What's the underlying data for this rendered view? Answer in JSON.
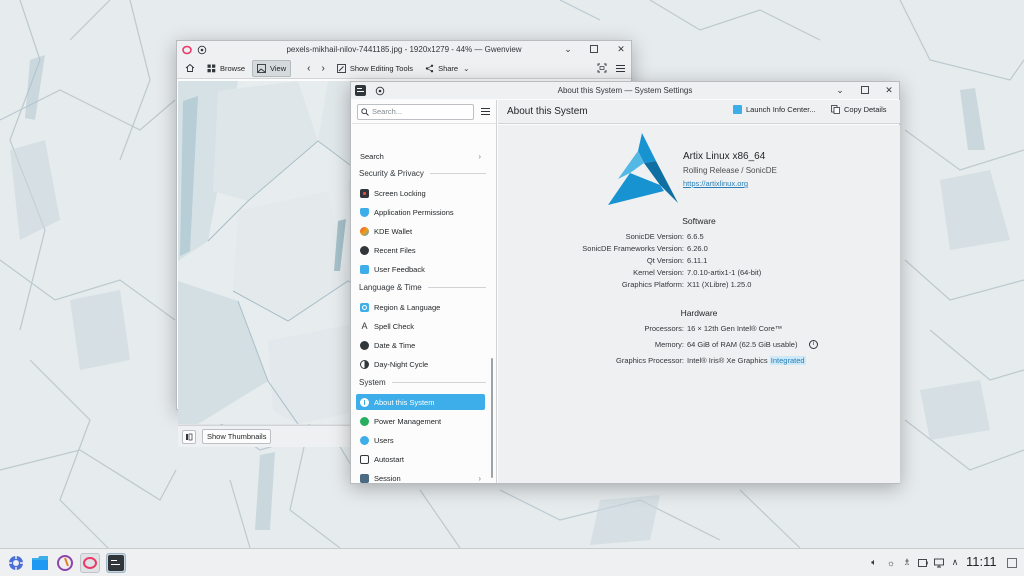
{
  "gwenview": {
    "title": "pexels-mikhail-nilov-7441185.jpg - 1920x1279 - 44% — Gwenview",
    "toolbar": {
      "browse": "Browse",
      "view": "View",
      "show_editing_tools": "Show Editing Tools",
      "share": "Share"
    },
    "show_thumbnails": "Show Thumbnails"
  },
  "settings": {
    "title": "About this System — System Settings",
    "search_placeholder": "Search...",
    "page_title": "About this System",
    "launch_info_center": "Launch Info Center...",
    "copy_details": "Copy Details",
    "sidebar": {
      "search": "Search",
      "security_privacy": "Security & Privacy",
      "screen_locking": "Screen Locking",
      "application_permissions": "Application Permissions",
      "kde_wallet": "KDE Wallet",
      "recent_files": "Recent Files",
      "user_feedback": "User Feedback",
      "language_time": "Language & Time",
      "region_language": "Region & Language",
      "spell_check": "Spell Check",
      "date_time": "Date & Time",
      "day_night_cycle": "Day-Night Cycle",
      "system": "System",
      "about_this_system": "About this System",
      "power_management": "Power Management",
      "users": "Users",
      "autostart": "Autostart",
      "session": "Session"
    },
    "distro": {
      "name": "Artix Linux x86_64",
      "release": "Rolling Release / SonicDE",
      "url": "https://artixlinux.org"
    },
    "software": {
      "heading": "Software",
      "rows": [
        {
          "key": "SonicDE Version:",
          "value": "6.6.5"
        },
        {
          "key": "SonicDE Frameworks Version:",
          "value": "6.26.0"
        },
        {
          "key": "Qt Version:",
          "value": "6.11.1"
        },
        {
          "key": "Kernel Version:",
          "value": "7.0.10-artix1-1 (64-bit)"
        },
        {
          "key": "Graphics Platform:",
          "value": "X11 (XLibre) 1.25.0"
        }
      ]
    },
    "hardware": {
      "heading": "Hardware",
      "processors_key": "Processors:",
      "processors_value": "16 × 12th Gen Intel® Core™",
      "memory_key": "Memory:",
      "memory_value": "64 GiB of RAM (62.5 GiB usable)",
      "gpu_key": "Graphics Processor:",
      "gpu_value": "Intel® Iris® Xe Graphics",
      "gpu_badge": "Integrated"
    }
  },
  "taskbar": {
    "clock": "11:11"
  },
  "colors": {
    "accent": "#3daee9",
    "artix_logo": "#1793d1"
  }
}
